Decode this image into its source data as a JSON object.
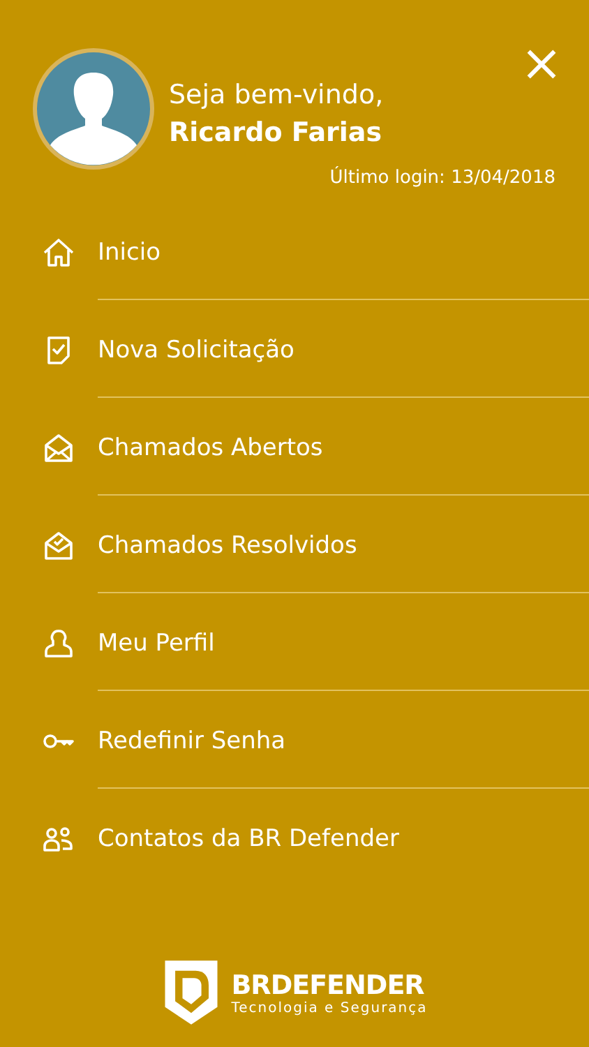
{
  "menu": {
    "greeting": "Seja bem-vindo,",
    "user_name": "Ricardo Farias",
    "last_login": "Último login: 13/04/2018",
    "items": [
      {
        "kind": "home",
        "label": "Inicio"
      },
      {
        "kind": "new",
        "label": "Nova Solicitação"
      },
      {
        "kind": "open",
        "label": "Chamados Abertos"
      },
      {
        "kind": "resolved",
        "label": "Chamados Resolvidos"
      },
      {
        "kind": "profile",
        "label": "Meu Perfil"
      },
      {
        "kind": "password",
        "label": "Redefinir Senha"
      },
      {
        "kind": "contacts",
        "label": "Contatos da BR Defender"
      }
    ],
    "logo": {
      "name": "BRDEFENDER",
      "tagline": "Tecnologia e Segurança"
    }
  }
}
